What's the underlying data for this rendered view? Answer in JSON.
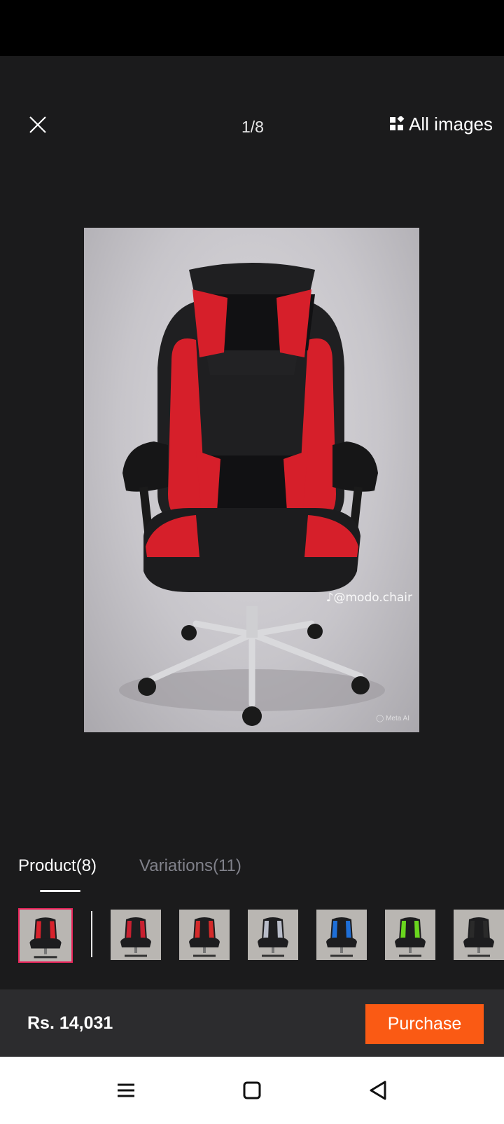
{
  "viewer": {
    "counter": "1/8",
    "all_images_label": "All images"
  },
  "image": {
    "watermark": "♪@modo.chair",
    "watermark_small": "◯ Meta AI"
  },
  "tabs": [
    {
      "label": "Product(8)",
      "active": true
    },
    {
      "label": "Variations(11)",
      "active": false
    }
  ],
  "thumbnails": [
    {
      "name": "red-black-chair",
      "accent": "#d8222c",
      "selected": true
    },
    {
      "name": "black-red-chair",
      "accent": "#c82030",
      "selected": false
    },
    {
      "name": "white-red-chair",
      "accent": "#d42a2a",
      "selected": false
    },
    {
      "name": "grey-white-chair",
      "accent": "#b8bcc8",
      "selected": false
    },
    {
      "name": "blue-black-chair",
      "accent": "#1e6fd8",
      "selected": false
    },
    {
      "name": "green-black-chair",
      "accent": "#6ad61e",
      "selected": false
    },
    {
      "name": "black-chair",
      "accent": "#2a2a2a",
      "selected": false
    }
  ],
  "footer": {
    "price": "Rs. 14,031",
    "purchase_label": "Purchase"
  },
  "colors": {
    "background": "#1b1b1c",
    "accent_orange": "#fa5a14",
    "selected_border": "#e8245a",
    "inactive_tab": "#80818a"
  }
}
